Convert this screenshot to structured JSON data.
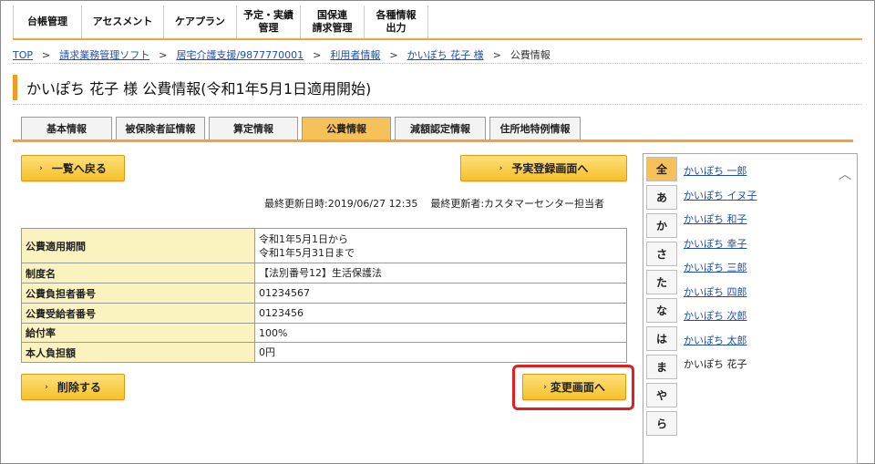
{
  "nav": {
    "items": [
      {
        "line1": "台帳管理",
        "line2": ""
      },
      {
        "line1": "アセスメント",
        "line2": ""
      },
      {
        "line1": "ケアプラン",
        "line2": ""
      },
      {
        "line1": "予定・実績",
        "line2": "管理"
      },
      {
        "line1": "国保連",
        "line2": "請求管理"
      },
      {
        "line1": "各種情報",
        "line2": "出力"
      }
    ]
  },
  "breadcrumb": {
    "links": [
      "TOP",
      "請求業務管理ソフト",
      "居宅介護支援/9877770001",
      "利用者情報",
      "かいぽち 花子 様"
    ],
    "current": "公費情報",
    "separator": ">"
  },
  "page": {
    "title": "かいぽち 花子 様 公費情報(令和1年5月1日適用開始)"
  },
  "tabs": [
    {
      "label": "基本情報",
      "active": false
    },
    {
      "label": "被保険者証情報",
      "active": false
    },
    {
      "label": "算定情報",
      "active": false
    },
    {
      "label": "公費情報",
      "active": true
    },
    {
      "label": "減額認定情報",
      "active": false
    },
    {
      "label": "住所地特例情報",
      "active": false
    }
  ],
  "buttons": {
    "back": "一覧へ戻る",
    "record": "予実登録画面へ",
    "delete": "削除する",
    "change": "変更画面へ"
  },
  "updated": {
    "datetime_label": "最終更新日時:",
    "datetime": "2019/06/27 12:35",
    "by_label": "最終更新者:",
    "by": "カスタマーセンター担当者"
  },
  "info": {
    "rows": [
      {
        "label": "公費適用期間",
        "value": "令和1年5月1日から",
        "value2": "令和1年5月31日まで"
      },
      {
        "label": "制度名",
        "value": "【法別番号12】生活保護法",
        "value2": ""
      },
      {
        "label": "公費負担者番号",
        "value": "01234567",
        "value2": ""
      },
      {
        "label": "公費受給者番号",
        "value": "0123456",
        "value2": ""
      },
      {
        "label": "給付率",
        "value": "100%",
        "value2": ""
      },
      {
        "label": "本人負担額",
        "value": "0円",
        "value2": ""
      }
    ]
  },
  "side": {
    "kana": [
      {
        "label": "全",
        "active": true
      },
      {
        "label": "あ",
        "active": false
      },
      {
        "label": "か",
        "active": false
      },
      {
        "label": "さ",
        "active": false
      },
      {
        "label": "た",
        "active": false
      },
      {
        "label": "な",
        "active": false
      },
      {
        "label": "は",
        "active": false
      },
      {
        "label": "ま",
        "active": false
      },
      {
        "label": "や",
        "active": false
      },
      {
        "label": "ら",
        "active": false
      }
    ],
    "names": [
      {
        "label": "かいぽち 一郎",
        "link": true
      },
      {
        "label": "かいぽち イヌ子",
        "link": true
      },
      {
        "label": "かいぽち 和子",
        "link": true
      },
      {
        "label": "かいぽち 幸子",
        "link": true
      },
      {
        "label": "かいぽち 三郎",
        "link": true
      },
      {
        "label": "かいぽち 四郎",
        "link": true
      },
      {
        "label": "かいぽち 次郎",
        "link": true
      },
      {
        "label": "かいぽち 太郎",
        "link": true
      },
      {
        "label": "かいぽち 花子",
        "link": false
      }
    ]
  },
  "colors": {
    "accent": "#f2a23a",
    "button": "#f5c12c",
    "active_tab": "#f7c15a",
    "label_cell": "#fbf3bf",
    "link": "#1f4fb5",
    "highlight": "#e02020"
  }
}
